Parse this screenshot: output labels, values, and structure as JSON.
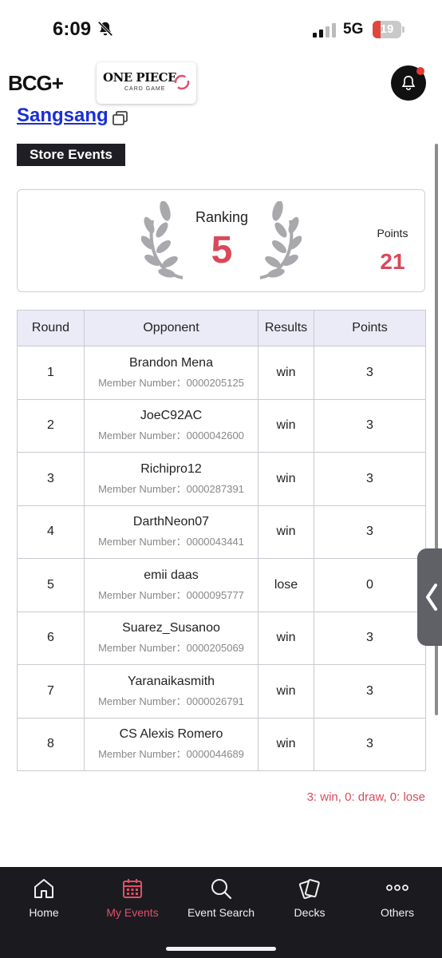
{
  "status_bar": {
    "time": "6:09",
    "network": "5G",
    "battery": "19"
  },
  "header": {
    "brand_logo_text": "BCG+",
    "game_logo_title": "ONE PIECE",
    "game_logo_subtitle": "CARD GAME"
  },
  "player": {
    "name": "Sangsang"
  },
  "section": {
    "title": "Store Events"
  },
  "ranking": {
    "label": "Ranking",
    "value": "5",
    "points_label": "Points",
    "points_value": "21"
  },
  "table": {
    "headers": [
      "Round",
      "Opponent",
      "Results",
      "Points"
    ],
    "member_prefix": "Member Number：",
    "rows": [
      {
        "round": "1",
        "opponent": "Brandon Mena",
        "member": "Member Number：0000205125",
        "result": "win",
        "points": "3"
      },
      {
        "round": "2",
        "opponent": "JoeC92AC",
        "member": "Member Number：0000042600",
        "result": "win",
        "points": "3"
      },
      {
        "round": "3",
        "opponent": "Richipro12",
        "member": "Member Number：0000287391",
        "result": "win",
        "points": "3"
      },
      {
        "round": "4",
        "opponent": "DarthNeon07",
        "member": "Member Number：0000043441",
        "result": "win",
        "points": "3"
      },
      {
        "round": "5",
        "opponent": "emii daas",
        "member": "Member Number：0000095777",
        "result": "lose",
        "points": "0"
      },
      {
        "round": "6",
        "opponent": "Suarez_Susanoo",
        "member": "Member Number：0000205069",
        "result": "win",
        "points": "3"
      },
      {
        "round": "7",
        "opponent": "Yaranaikasmith",
        "member": "Member Number：0000026791",
        "result": "win",
        "points": "3"
      },
      {
        "round": "8",
        "opponent": "CS Alexis Romero",
        "member": "Member Number：0000044689",
        "result": "win",
        "points": "3"
      }
    ]
  },
  "legend": "3: win, 0: draw, 0: lose",
  "nav": {
    "items": [
      {
        "label": "Home",
        "icon": "home-icon"
      },
      {
        "label": "My Events",
        "icon": "calendar-icon",
        "active": true
      },
      {
        "label": "Event Search",
        "icon": "search-icon"
      },
      {
        "label": "Decks",
        "icon": "cards-icon"
      },
      {
        "label": "Others",
        "icon": "more-icon"
      }
    ]
  },
  "colors": {
    "accent": "#d9485b",
    "link": "#1a2fd6",
    "nav_bg": "#1b1b1f",
    "header_cell_bg": "#ebebf7"
  }
}
